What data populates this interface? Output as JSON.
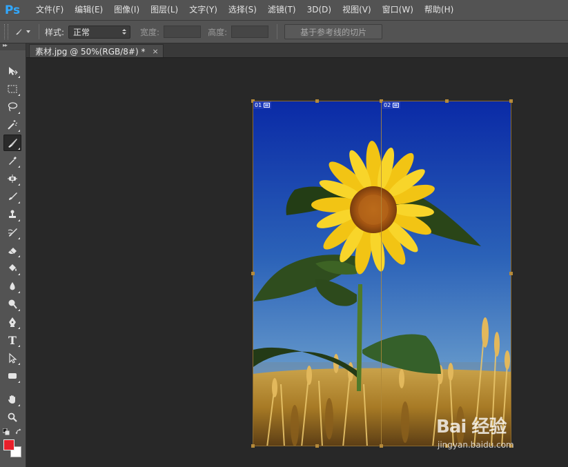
{
  "app": {
    "logo": "Ps",
    "accent": "#31a8ff"
  },
  "menu": [
    "文件(F)",
    "编辑(E)",
    "图像(I)",
    "图层(L)",
    "文字(Y)",
    "选择(S)",
    "滤镜(T)",
    "3D(D)",
    "视图(V)",
    "窗口(W)",
    "帮助(H)"
  ],
  "options": {
    "style_label": "样式:",
    "style_value": "正常",
    "width_label": "宽度:",
    "height_label": "高度:",
    "slices_from_guides": "基于参考线的切片"
  },
  "document": {
    "tab_title": "素材.jpg @ 50%(RGB/8#) *",
    "close": "×"
  },
  "slices": [
    {
      "number": "01"
    },
    {
      "number": "02"
    }
  ],
  "tools": [
    "move-tool",
    "marquee-tool",
    "lasso-tool",
    "magic-wand-tool",
    "slice-tool",
    "eyedropper-tool",
    "spot-healing-tool",
    "brush-tool",
    "clone-stamp-tool",
    "history-brush-tool",
    "eraser-tool",
    "paint-bucket-tool",
    "blur-tool",
    "dodge-tool",
    "pen-tool",
    "type-tool",
    "path-selection-tool",
    "rectangle-tool",
    "hand-tool",
    "zoom-tool"
  ],
  "type_tool_glyph": "T",
  "colors": {
    "foreground": "#e8202a",
    "background": "#ffffff"
  },
  "watermark": {
    "main": "Bai 经验",
    "sub": "jingyan.baidu.com"
  }
}
